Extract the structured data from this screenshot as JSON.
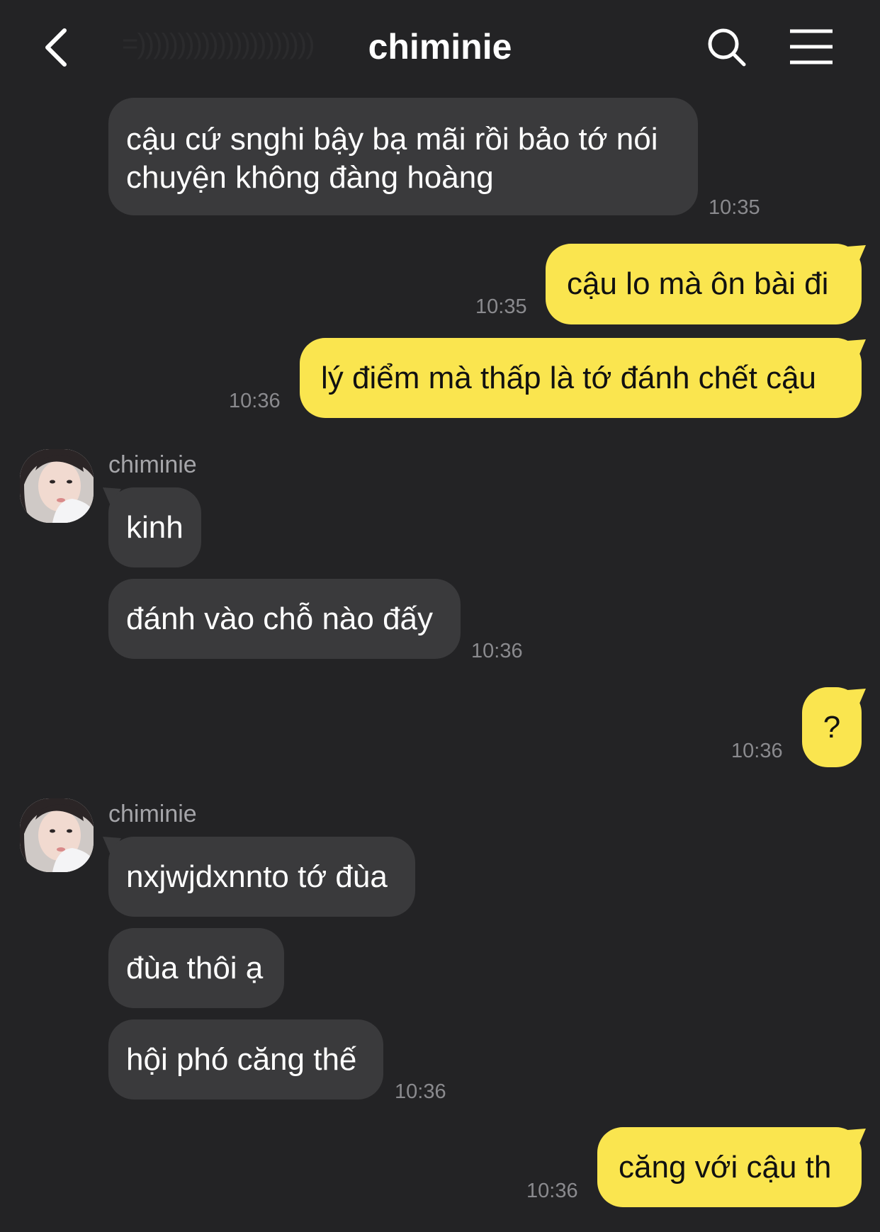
{
  "header": {
    "title": "chiminie",
    "watermark": "=))))))))))))))))))))))"
  },
  "icons": {
    "back": "back-arrow-icon",
    "search": "search-icon",
    "menu": "menu-icon"
  },
  "colors": {
    "background": "#232325",
    "incoming_bubble": "#3a3a3c",
    "outgoing_bubble": "#fae54f",
    "timestamp": "#8a8a8e"
  },
  "messages": [
    {
      "id": "m1",
      "direction": "in",
      "text_lines": [
        "cậu cứ snghi bậy bạ mãi rồi bảo tớ nói",
        "chuyện không đàng hoàng"
      ],
      "time": "10:35"
    },
    {
      "id": "m2",
      "direction": "out",
      "text": "cậu lo mà ôn bài đi",
      "time": "10:35"
    },
    {
      "id": "m3",
      "direction": "out",
      "text": "lý điểm mà thấp là tớ đánh chết cậu",
      "time": "10:36"
    },
    {
      "id": "g1",
      "sender": "chiminie"
    },
    {
      "id": "m4",
      "direction": "in",
      "text": "kinh"
    },
    {
      "id": "m5",
      "direction": "in",
      "text": "đánh vào chỗ nào đấy",
      "time": "10:36"
    },
    {
      "id": "m6",
      "direction": "out",
      "text": "?",
      "time": "10:36"
    },
    {
      "id": "g2",
      "sender": "chiminie"
    },
    {
      "id": "m7",
      "direction": "in",
      "text": "nxjwjdxnnto tớ đùa"
    },
    {
      "id": "m8",
      "direction": "in",
      "text": "đùa thôi ạ"
    },
    {
      "id": "m9",
      "direction": "in",
      "text": "hội phó căng thế",
      "time": "10:36"
    },
    {
      "id": "m10",
      "direction": "out",
      "text": "căng với cậu th",
      "time": "10:36"
    }
  ]
}
